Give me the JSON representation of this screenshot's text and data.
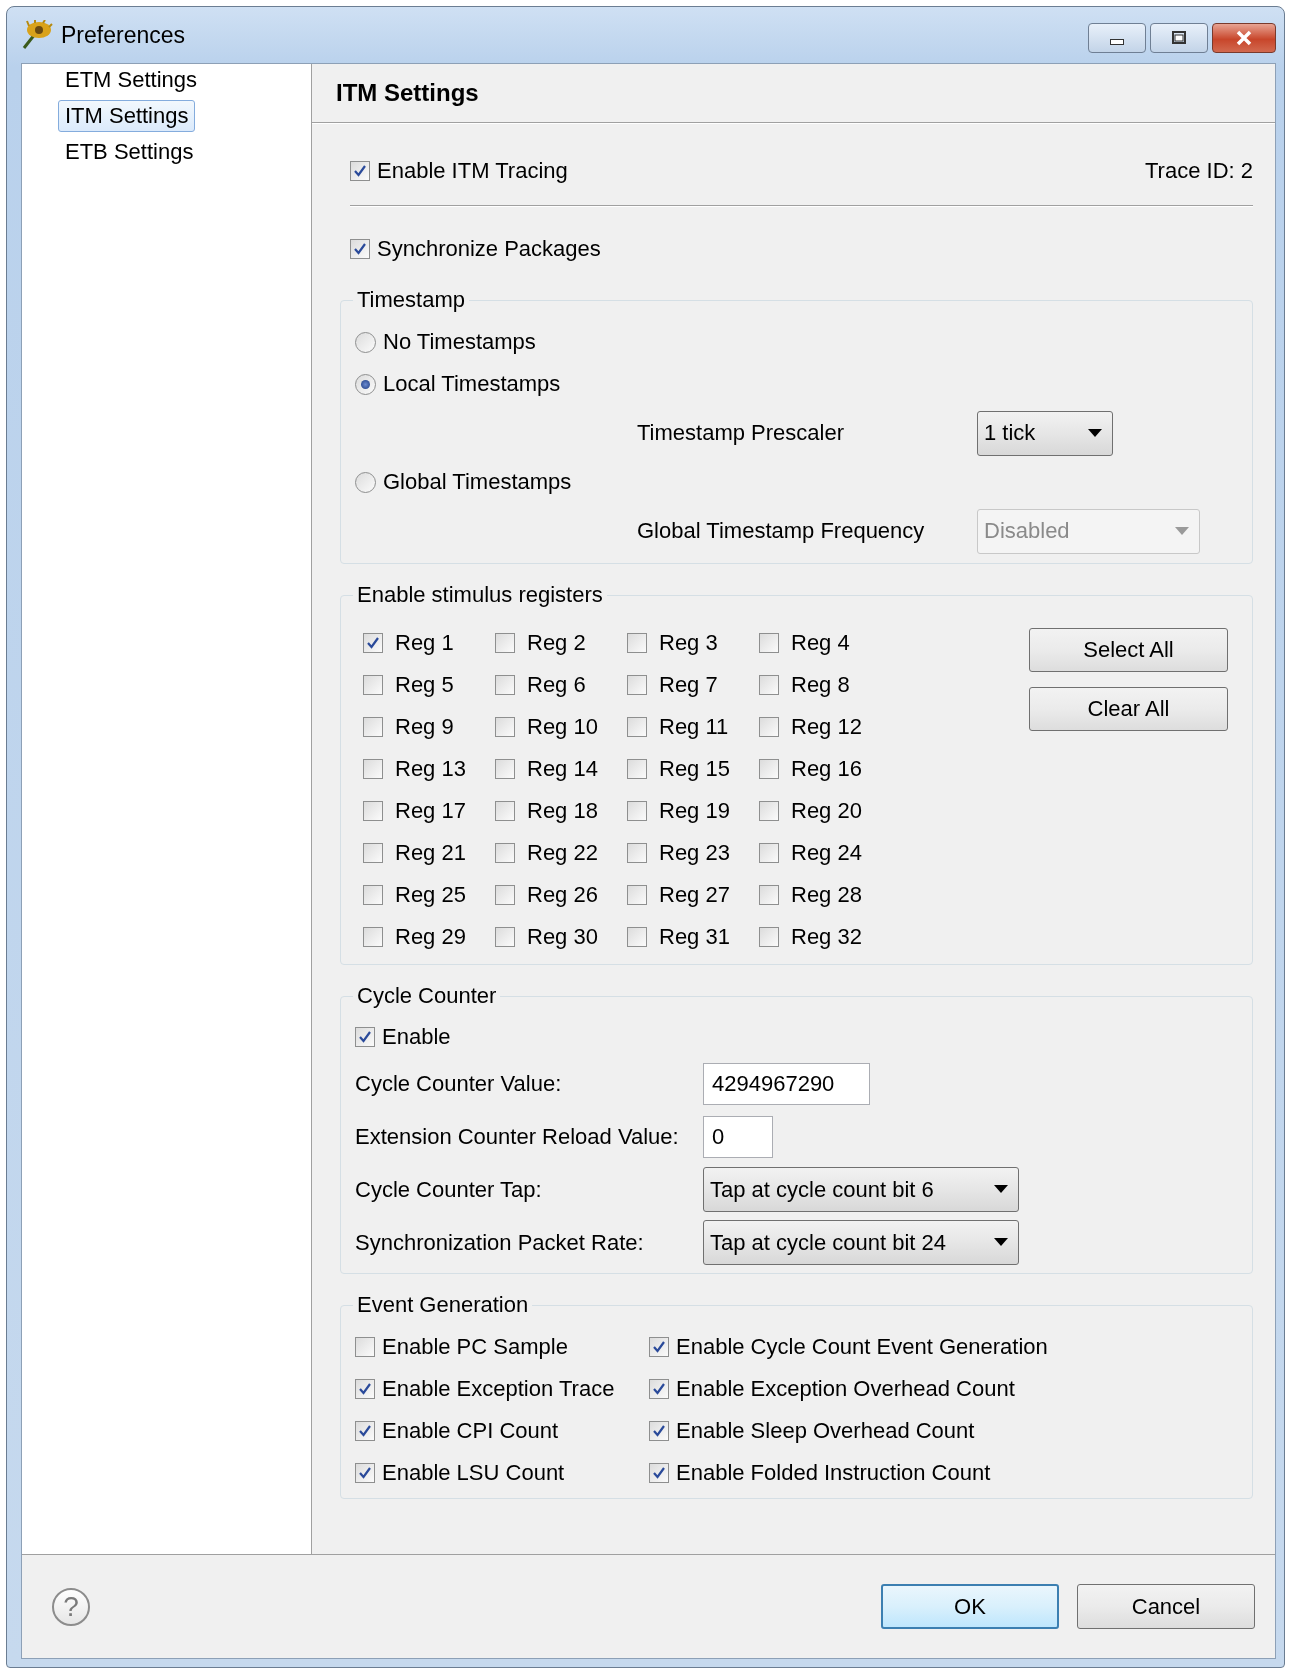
{
  "window": {
    "title": "Preferences"
  },
  "sidebar": {
    "items": [
      {
        "label": "ETM Settings",
        "selected": false
      },
      {
        "label": "ITM Settings",
        "selected": true
      },
      {
        "label": "ETB Settings",
        "selected": false
      }
    ]
  },
  "page": {
    "title": "ITM Settings"
  },
  "tracing": {
    "label": "Enable ITM Tracing",
    "checked": true,
    "trace_id": "Trace ID: 2"
  },
  "sync": {
    "label": "Synchronize Packages",
    "checked": true
  },
  "timestamp": {
    "title": "Timestamp",
    "options": [
      {
        "label": "No Timestamps",
        "selected": false
      },
      {
        "label": "Local Timestamps",
        "selected": true,
        "setting": {
          "label": "Timestamp Prescaler",
          "value": "1 tick",
          "disabled": false
        }
      },
      {
        "label": "Global Timestamps",
        "selected": false,
        "setting": {
          "label": "Global Timestamp Frequency",
          "value": "Disabled",
          "disabled": true
        }
      }
    ]
  },
  "stimulus": {
    "title": "Enable stimulus registers",
    "registers": [
      {
        "label": "Reg 1",
        "checked": true
      },
      {
        "label": "Reg 2",
        "checked": false
      },
      {
        "label": "Reg 3",
        "checked": false
      },
      {
        "label": "Reg 4",
        "checked": false
      },
      {
        "label": "Reg 5",
        "checked": false
      },
      {
        "label": "Reg 6",
        "checked": false
      },
      {
        "label": "Reg 7",
        "checked": false
      },
      {
        "label": "Reg 8",
        "checked": false
      },
      {
        "label": "Reg 9",
        "checked": false
      },
      {
        "label": "Reg 10",
        "checked": false
      },
      {
        "label": "Reg 11",
        "checked": false
      },
      {
        "label": "Reg 12",
        "checked": false
      },
      {
        "label": "Reg 13",
        "checked": false
      },
      {
        "label": "Reg 14",
        "checked": false
      },
      {
        "label": "Reg 15",
        "checked": false
      },
      {
        "label": "Reg 16",
        "checked": false
      },
      {
        "label": "Reg 17",
        "checked": false
      },
      {
        "label": "Reg 18",
        "checked": false
      },
      {
        "label": "Reg 19",
        "checked": false
      },
      {
        "label": "Reg 20",
        "checked": false
      },
      {
        "label": "Reg 21",
        "checked": false
      },
      {
        "label": "Reg 22",
        "checked": false
      },
      {
        "label": "Reg 23",
        "checked": false
      },
      {
        "label": "Reg 24",
        "checked": false
      },
      {
        "label": "Reg 25",
        "checked": false
      },
      {
        "label": "Reg 26",
        "checked": false
      },
      {
        "label": "Reg 27",
        "checked": false
      },
      {
        "label": "Reg 28",
        "checked": false
      },
      {
        "label": "Reg 29",
        "checked": false
      },
      {
        "label": "Reg 30",
        "checked": false
      },
      {
        "label": "Reg 31",
        "checked": false
      },
      {
        "label": "Reg 32",
        "checked": false
      }
    ],
    "buttons": [
      "Select All",
      "Clear All"
    ]
  },
  "cycle_counter": {
    "title": "Cycle Counter",
    "enable": {
      "label": "Enable",
      "checked": true
    },
    "fields": [
      {
        "kind": "text",
        "label": "Cycle Counter Value:",
        "value": "4294967290"
      },
      {
        "kind": "text",
        "label": "Extension Counter Reload Value:",
        "value": "0"
      },
      {
        "kind": "dropdown",
        "label": "Cycle Counter Tap:",
        "value": "Tap at cycle count bit 6"
      },
      {
        "kind": "dropdown",
        "label": "Synchronization Packet Rate:",
        "value": "Tap at cycle count bit 24"
      }
    ]
  },
  "event_generation": {
    "title": "Event Generation",
    "options": [
      {
        "label": "Enable PC Sample",
        "checked": false
      },
      {
        "label": "Enable Cycle Count Event Generation",
        "checked": true
      },
      {
        "label": "Enable Exception Trace",
        "checked": true
      },
      {
        "label": "Enable Exception Overhead Count",
        "checked": true
      },
      {
        "label": "Enable CPI Count",
        "checked": true
      },
      {
        "label": "Enable Sleep Overhead Count",
        "checked": true
      },
      {
        "label": "Enable LSU Count",
        "checked": true
      },
      {
        "label": "Enable Folded Instruction Count",
        "checked": true
      }
    ]
  },
  "help": "?",
  "buttons": [
    {
      "label": "OK",
      "default": true
    },
    {
      "label": "Cancel",
      "default": false
    }
  ]
}
